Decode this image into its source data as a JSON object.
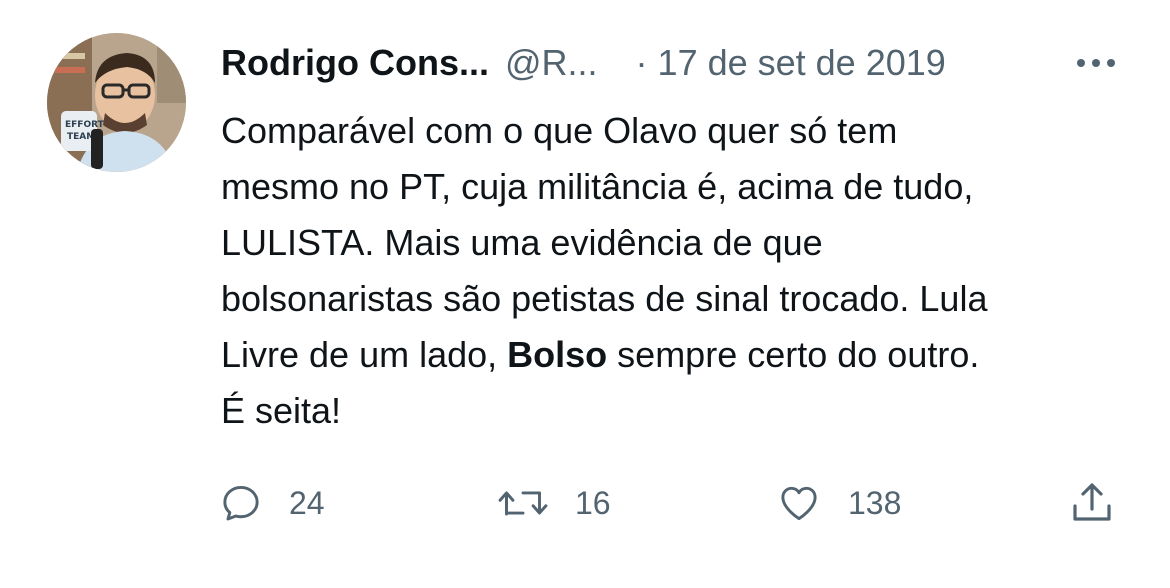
{
  "author": {
    "display_name": "Rodrigo Cons...",
    "handle": "@R...",
    "avatar_badge_text": "EFFORT TEAM"
  },
  "meta": {
    "separator": "·",
    "date": "17 de set de 2019"
  },
  "more_icon": "more-horizontal-icon",
  "tweet": {
    "line1": "Comparável com o que Olavo quer só tem",
    "line2": "mesmo no PT, cuja militância é, acima de tudo,",
    "line3": "LULISTA. Mais uma evidência de que",
    "line4": "bolsonaristas são petistas de sinal trocado. Lula",
    "line5_pre": "Livre de um lado, ",
    "line5_bold": "Bolso",
    "line5_post": " sempre certo do outro.",
    "line6": "É seita!"
  },
  "actions": {
    "reply": {
      "icon": "reply-icon",
      "count": "24"
    },
    "retweet": {
      "icon": "retweet-icon",
      "count": "16"
    },
    "like": {
      "icon": "heart-icon",
      "count": "138"
    },
    "share": {
      "icon": "share-icon"
    }
  },
  "colors": {
    "text": "#0f1419",
    "secondary": "#536471",
    "background": "#ffffff"
  }
}
